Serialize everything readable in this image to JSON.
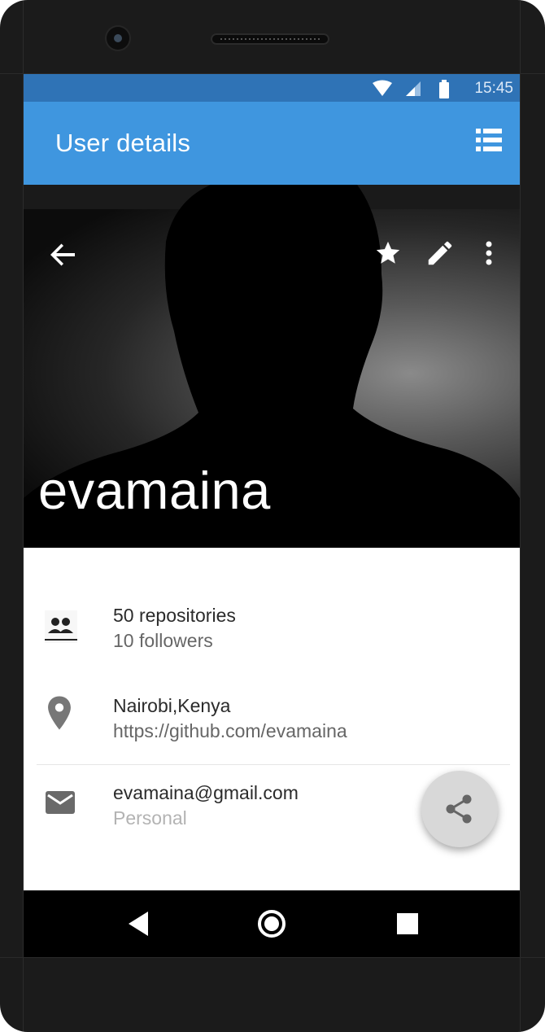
{
  "status_bar": {
    "time": "15:45"
  },
  "app_bar": {
    "title": "User details",
    "list_icon": "view-list-icon"
  },
  "hero": {
    "username": "evamaina",
    "back_icon": "arrow-back-icon",
    "star_icon": "star-icon",
    "edit_icon": "pencil-icon",
    "more_icon": "more-vert-icon"
  },
  "details": {
    "stats": {
      "repositories": "50 repositories",
      "followers": "10 followers"
    },
    "location": {
      "place": "Nairobi,Kenya",
      "url": "https://github.com/evamaina"
    },
    "email": {
      "address": "evamaina@gmail.com",
      "type": "Personal"
    }
  },
  "fab": {
    "icon": "share-icon"
  },
  "nav_bar": {
    "back": "back-triangle-icon",
    "home": "home-circle-icon",
    "recents": "recents-square-icon"
  },
  "colors": {
    "status_bar": "#2f73b6",
    "app_bar": "#3f96df",
    "fab": "#d8d8d8"
  }
}
